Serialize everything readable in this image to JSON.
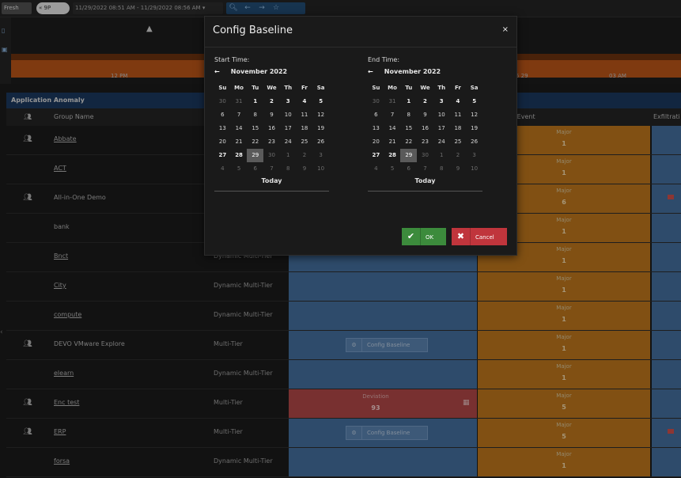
{
  "topbar": {
    "refresh_label": "Fresh rest",
    "toggle_label": "« 9P",
    "range_label": "11/29/2022 08:51 AM - 11/29/2022 08:56 AM",
    "range_caret": "▾",
    "icons": [
      "zoom-icon",
      "back-icon",
      "forward-icon",
      "star-icon"
    ]
  },
  "timeline": {
    "ticks": [
      "12 PM",
      "5 29",
      "03 AM"
    ]
  },
  "anomaly": {
    "header": "Application Anomaly",
    "columns": {
      "group_name": "Group Name",
      "event": "t Event",
      "exfiltration": "Exfiltrati"
    },
    "rows": [
      {
        "name": "Abbate",
        "type": "",
        "icon": true,
        "sev_label": "Major",
        "sev_count": "1"
      },
      {
        "name": "ACT",
        "type": "",
        "icon": false,
        "sev_label": "Major",
        "sev_count": "1"
      },
      {
        "name": "All-in-One Demo",
        "type": "",
        "icon": true,
        "sev_label": "Major",
        "sev_count": "6",
        "flag": true
      },
      {
        "name": "bank",
        "type": "",
        "icon": false,
        "sev_label": "Major",
        "sev_count": "1"
      },
      {
        "name": "Bnct",
        "type": "Dynamic Multi-Tier",
        "icon": false,
        "sev_label": "Major",
        "sev_count": "1"
      },
      {
        "name": "City",
        "type": "Dynamic Multi-Tier",
        "icon": false,
        "sev_label": "Major",
        "sev_count": "1"
      },
      {
        "name": "compute",
        "type": "Dynamic Multi-Tier",
        "icon": false,
        "sev_label": "Major",
        "sev_count": "1"
      },
      {
        "name": "DEVO VMware Explore",
        "type": "Multi-Tier",
        "icon": true,
        "config": "Config Baseline",
        "sev_label": "Major",
        "sev_count": "1"
      },
      {
        "name": "elearn",
        "type": "Dynamic Multi-Tier",
        "icon": false,
        "sev_label": "Major",
        "sev_count": "1"
      },
      {
        "name": "Enc test",
        "type": "Multi-Tier",
        "icon": true,
        "deviation_label": "Deviation",
        "deviation_value": "93",
        "sev_label": "Major",
        "sev_count": "5"
      },
      {
        "name": "ERP",
        "type": "Multi-Tier",
        "icon": true,
        "config": "Config Baseline",
        "sev_label": "Major",
        "sev_count": "5",
        "flag": true
      },
      {
        "name": "forsa",
        "type": "Dynamic Multi-Tier",
        "icon": false,
        "sev_label": "Major",
        "sev_count": "1"
      }
    ]
  },
  "modal": {
    "title": "Config Baseline",
    "close": "×",
    "start": {
      "label": "Start Time:",
      "month": "November 2022",
      "today": "Today"
    },
    "end": {
      "label": "End Time:",
      "month": "November 2022",
      "today": "Today"
    },
    "weekdays": [
      "Su",
      "Mo",
      "Tu",
      "We",
      "Th",
      "Fr",
      "Sa"
    ],
    "days": [
      {
        "v": "30",
        "k": "o"
      },
      {
        "v": "31",
        "k": "o"
      },
      {
        "v": "1",
        "k": "b"
      },
      {
        "v": "2",
        "k": "b"
      },
      {
        "v": "3",
        "k": "b"
      },
      {
        "v": "4",
        "k": "b"
      },
      {
        "v": "5",
        "k": "b"
      },
      {
        "v": "6",
        "k": "d"
      },
      {
        "v": "7",
        "k": "d"
      },
      {
        "v": "8",
        "k": "d"
      },
      {
        "v": "9",
        "k": "d"
      },
      {
        "v": "10",
        "k": "d"
      },
      {
        "v": "11",
        "k": "d"
      },
      {
        "v": "12",
        "k": "d"
      },
      {
        "v": "13",
        "k": "d"
      },
      {
        "v": "14",
        "k": "d"
      },
      {
        "v": "15",
        "k": "d"
      },
      {
        "v": "16",
        "k": "d"
      },
      {
        "v": "17",
        "k": "d"
      },
      {
        "v": "18",
        "k": "d"
      },
      {
        "v": "19",
        "k": "d"
      },
      {
        "v": "20",
        "k": "d"
      },
      {
        "v": "21",
        "k": "d"
      },
      {
        "v": "22",
        "k": "d"
      },
      {
        "v": "23",
        "k": "d"
      },
      {
        "v": "24",
        "k": "d"
      },
      {
        "v": "25",
        "k": "d"
      },
      {
        "v": "26",
        "k": "d"
      },
      {
        "v": "27",
        "k": "b"
      },
      {
        "v": "28",
        "k": "b"
      },
      {
        "v": "29",
        "k": "sel"
      },
      {
        "v": "30",
        "k": "o"
      },
      {
        "v": "1",
        "k": "o"
      },
      {
        "v": "2",
        "k": "o"
      },
      {
        "v": "3",
        "k": "o"
      },
      {
        "v": "4",
        "k": "o"
      },
      {
        "v": "5",
        "k": "o"
      },
      {
        "v": "6",
        "k": "o"
      },
      {
        "v": "7",
        "k": "o"
      },
      {
        "v": "8",
        "k": "o"
      },
      {
        "v": "9",
        "k": "o"
      },
      {
        "v": "10",
        "k": "o"
      }
    ],
    "ok_label": "OK",
    "cancel_label": "Cancel"
  }
}
